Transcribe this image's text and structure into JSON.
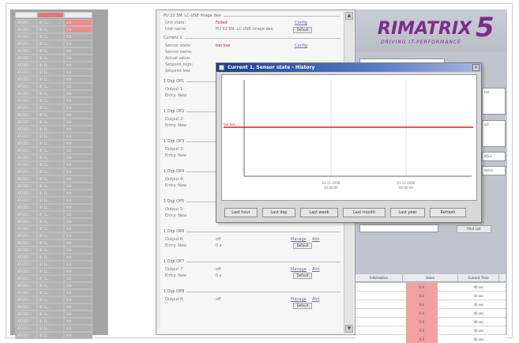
{
  "brand": {
    "logo_text": "RIMATRIX",
    "logo_number": "5",
    "tagline": "DRIVING IT-PERFORMANCE"
  },
  "left_panel": {
    "header_cells": [
      "",
      "",
      ""
    ],
    "rows": [
      {
        "c1": "AT-C07...",
        "c2": "B: 1L...",
        "c3": "0.0",
        "red": true
      },
      {
        "c1": "AT-C07...",
        "c2": "B: 1L...",
        "c3": "0.0",
        "red": true
      },
      {
        "c1": "AT-C07...",
        "c2": "B: 1L...",
        "c3": "0.0",
        "red": false
      },
      {
        "c1": "AT-C07...",
        "c2": "B: 1L...",
        "c3": "0.0",
        "red": false
      },
      {
        "c1": "AT-C07...",
        "c2": "B: 1L...",
        "c3": "0.0",
        "red": false
      },
      {
        "c1": "AT-C07...",
        "c2": "B: 1L...",
        "c3": "0.0",
        "red": false
      },
      {
        "c1": "AT-C07...",
        "c2": "B: 1L...",
        "c3": "0.0",
        "red": false
      },
      {
        "c1": "AT-C07...",
        "c2": "B: 1L...",
        "c3": "0.0",
        "red": false
      },
      {
        "c1": "AT-C07...",
        "c2": "B: 1L...",
        "c3": "0.0",
        "red": false
      },
      {
        "c1": "AT-C07...",
        "c2": "B: 1L...",
        "c3": "0.0",
        "red": false
      },
      {
        "c1": "AT-C07...",
        "c2": "B: 1L...",
        "c3": "0.0",
        "red": false
      },
      {
        "c1": "AT-C07...",
        "c2": "B: 1L...",
        "c3": "0.0",
        "red": false
      },
      {
        "c1": "AT-C07...",
        "c2": "B: 1L...",
        "c3": "0.0",
        "red": false
      },
      {
        "c1": "AT-C07...",
        "c2": "B: 1L...",
        "c3": "0.0",
        "red": false
      },
      {
        "c1": "AT-C07...",
        "c2": "B: 1L...",
        "c3": "0.0",
        "red": false
      },
      {
        "c1": "AT-C07...",
        "c2": "B: 1L...",
        "c3": "0.0",
        "red": false
      },
      {
        "c1": "AT-C07...",
        "c2": "B: 1L...",
        "c3": "0.0",
        "red": false
      },
      {
        "c1": "AT-C07...",
        "c2": "B: 1L...",
        "c3": "0.0",
        "red": false
      },
      {
        "c1": "AT-C07...",
        "c2": "B: 1L...",
        "c3": "0.0",
        "red": false
      },
      {
        "c1": "AT-C07...",
        "c2": "B: 1L...",
        "c3": "0.0",
        "red": false
      },
      {
        "c1": "AT-C07...",
        "c2": "B: 1L...",
        "c3": "0.0",
        "red": false
      },
      {
        "c1": "AT-C07...",
        "c2": "B: 1L...",
        "c3": "0.0",
        "red": false
      },
      {
        "c1": "AT-C07...",
        "c2": "B: 1L...",
        "c3": "0.0",
        "red": false
      },
      {
        "c1": "AT-C07...",
        "c2": "B: 1L...",
        "c3": "0.0",
        "red": false
      },
      {
        "c1": "AT-C07...",
        "c2": "B: 1L...",
        "c3": "0.0",
        "red": false
      },
      {
        "c1": "AT-C07...",
        "c2": "B: 1L...",
        "c3": "0.0",
        "red": false
      },
      {
        "c1": "AT-C07...",
        "c2": "B: 1L...",
        "c3": "0.0",
        "red": false
      },
      {
        "c1": "AT-C07...",
        "c2": "B: 1L...",
        "c3": "0.0",
        "red": false
      },
      {
        "c1": "AT-C07...",
        "c2": "B: 1L...",
        "c3": "0.0",
        "red": false
      },
      {
        "c1": "AT-C07...",
        "c2": "B: 1L...",
        "c3": "0.0",
        "red": false
      },
      {
        "c1": "AT-C07...",
        "c2": "B: 1L...",
        "c3": "0.0",
        "red": false
      },
      {
        "c1": "AT-C07...",
        "c2": "B: 1L...",
        "c3": "0.0",
        "red": false
      },
      {
        "c1": "AT-C07...",
        "c2": "B: 1L...",
        "c3": "0.0",
        "red": false
      },
      {
        "c1": "AT-C07...",
        "c2": "B: 1L...",
        "c3": "0.0",
        "red": false
      },
      {
        "c1": "AT-C07...",
        "c2": "B: 1L...",
        "c3": "0.0",
        "red": false
      },
      {
        "c1": "AT-C07...",
        "c2": "B: 1L...",
        "c3": "0.0",
        "red": false
      },
      {
        "c1": "AT-C07...",
        "c2": "B: 1L...",
        "c3": "0.0",
        "red": false
      },
      {
        "c1": "AT-C07...",
        "c2": "B: 1L...",
        "c3": "0.0",
        "red": false
      },
      {
        "c1": "AT-C07...",
        "c2": "B: 1L...",
        "c3": "0.0",
        "red": false
      },
      {
        "c1": "AT-C07...",
        "c2": "B: 1L...",
        "c3": "0.0",
        "red": false
      },
      {
        "c1": "AT-C07...",
        "c2": "B: 1L...",
        "c3": "0.0",
        "red": false
      },
      {
        "c1": "AT-C07...",
        "c2": "B: 1L...",
        "c3": "0.0",
        "red": false
      },
      {
        "c1": "AT-C07...",
        "c2": "B: 1L...",
        "c3": "0.0",
        "red": false
      },
      {
        "c1": "AT-C07...",
        "c2": "B: 1L...",
        "c3": "0.0",
        "red": false
      },
      {
        "c1": "AT-C07...",
        "c2": "B: 1L...",
        "c3": "0.0",
        "red": false
      }
    ]
  },
  "center_panel": {
    "header_group": "PU 32 SN: LC-USB image dev",
    "unit_state_label": "Unit state:",
    "unit_state_value": "Failed",
    "unit_name_label": "Unit name:",
    "unit_name_value": "PU 32 SN: LC-USB image dev",
    "config_label": "Config",
    "default_label": "Default",
    "current_group": "Current 1",
    "sensor_state_label": "Sensor state:",
    "sensor_state_value": "too low",
    "sensor_name_label": "Sensor name:",
    "actual_value_label": "Actual value:",
    "setpoint_high_label": "Setpoint high:",
    "setpoint_low_label": "Setpoint low:",
    "outputs": [
      {
        "group": "1 Digi OP1",
        "output_label": "Output 1:",
        "delay_label": "Entry: New",
        "value": "",
        "delay": ""
      },
      {
        "group": "1 Digi OP2",
        "output_label": "Output 2:",
        "delay_label": "Entry: New",
        "value": "",
        "delay": ""
      },
      {
        "group": "1 Digi OP3",
        "output_label": "Output 3:",
        "delay_label": "Entry: New",
        "value": "",
        "delay": ""
      },
      {
        "group": "1 Digi OP4",
        "output_label": "Output 4:",
        "delay_label": "Entry: New",
        "value": "",
        "delay": ""
      },
      {
        "group": "1 Digi OP5",
        "output_label": "Output 5:",
        "delay_label": "Entry: New",
        "value": "off",
        "delay": "0 s"
      },
      {
        "group": "1 Digi OP6",
        "output_label": "Output 6:",
        "delay_label": "Entry: New",
        "value": "off",
        "delay": "0 s"
      },
      {
        "group": "1 Digi OP7",
        "output_label": "Output 7:",
        "delay_label": "Entry: New",
        "value": "off",
        "delay": "0 s"
      },
      {
        "group": "1 Digi OP8",
        "output_label": "Output 8:",
        "delay_label": "",
        "value": "off",
        "delay": ""
      }
    ],
    "manage_label": "Manage",
    "alarm_label": "Alm",
    "default_btn": "Default"
  },
  "popup": {
    "title": "Current 1, Sensor state - History",
    "series_label": "too low",
    "x_ticks": [
      {
        "date": "01.11.2008",
        "time": "00:00:00"
      },
      {
        "date": "01.11.2008",
        "time": "00:00:00"
      }
    ],
    "buttons": [
      "Last hour",
      "Last day",
      "Last week",
      "Last month",
      "Last year",
      "Refresh"
    ],
    "close_glyph": "×",
    "line_color": "#d32020"
  },
  "chart_data": {
    "type": "line",
    "title": "Current 1, Sensor state - History",
    "x_ticks": [
      "01.11.2008 00:00:00",
      "01.11.2008 00:00:00"
    ],
    "series": [
      {
        "name": "too low",
        "values": [
          1,
          1
        ]
      }
    ],
    "y_categories": [
      "too low"
    ],
    "grid": true
  },
  "right_panel": {
    "table_headers": [
      "Information",
      "Value",
      "Current Time"
    ],
    "table_rows": [
      {
        "info": "",
        "value": "0.0",
        "time": "00 sec"
      },
      {
        "info": "",
        "value": "0.0",
        "time": "00 sec"
      },
      {
        "info": "",
        "value": "0.0",
        "time": "00 sec"
      },
      {
        "info": "",
        "value": "0.0",
        "time": "00 sec"
      },
      {
        "info": "",
        "value": "0.0",
        "time": "00 sec"
      },
      {
        "info": "",
        "value": "0.0",
        "time": "00 sec"
      },
      {
        "info": "",
        "value": "0.0",
        "time": "00 sec"
      }
    ],
    "print_button": "Print List",
    "side_labels": [
      "nor",
      "ort",
      "dlice",
      "dalon"
    ]
  }
}
